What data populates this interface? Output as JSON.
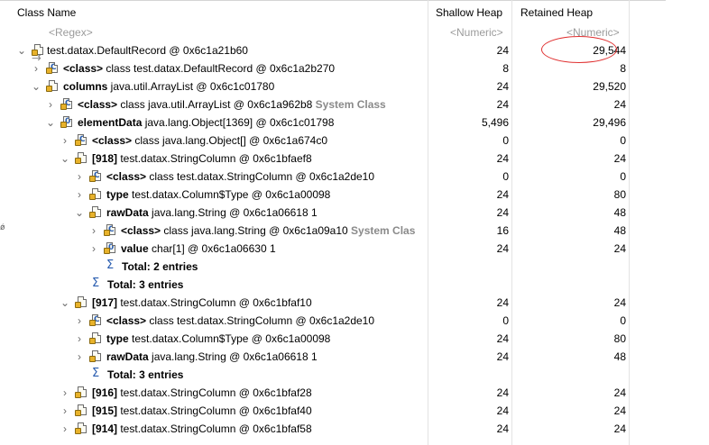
{
  "columns": {
    "class_name": "Class Name",
    "shallow": "Shallow Heap",
    "retained": "Retained Heap"
  },
  "filters": {
    "regex": "<Regex>",
    "numeric1": "<Numeric>",
    "numeric2": "<Numeric>"
  },
  "rows": [
    {
      "bold": "",
      "text": "test.datax.DefaultRecord @ 0x6c1a21b60",
      "extra": "",
      "shallow": "24",
      "retained": "29,544"
    },
    {
      "bold": "<class>",
      "text": " class test.datax.DefaultRecord @ 0x6c1a2b270",
      "extra": "",
      "shallow": "8",
      "retained": "8"
    },
    {
      "bold": "columns",
      "text": " java.util.ArrayList @ 0x6c1c01780",
      "extra": "",
      "shallow": "24",
      "retained": "29,520"
    },
    {
      "bold": "<class>",
      "text": " class java.util.ArrayList @ 0x6c1a962b8",
      "extra": " System Class",
      "shallow": "24",
      "retained": "24"
    },
    {
      "bold": "elementData",
      "text": " java.lang.Object[1369] @ 0x6c1c01798",
      "extra": "",
      "shallow": "5,496",
      "retained": "29,496"
    },
    {
      "bold": "<class>",
      "text": " class java.lang.Object[] @ 0x6c1a674c0",
      "extra": "",
      "shallow": "0",
      "retained": "0"
    },
    {
      "bold": "[918]",
      "text": " test.datax.StringColumn @ 0x6c1bfaef8",
      "extra": "",
      "shallow": "24",
      "retained": "24"
    },
    {
      "bold": "<class>",
      "text": " class test.datax.StringColumn @ 0x6c1a2de10",
      "extra": "",
      "shallow": "0",
      "retained": "0"
    },
    {
      "bold": "type",
      "text": " test.datax.Column$Type @ 0x6c1a00098",
      "extra": "",
      "shallow": "24",
      "retained": "80"
    },
    {
      "bold": "rawData",
      "text": " java.lang.String @ 0x6c1a06618  1",
      "extra": "",
      "shallow": "24",
      "retained": "48"
    },
    {
      "bold": "<class>",
      "text": " class java.lang.String @ 0x6c1a09a10",
      "extra": " System Clas",
      "shallow": "16",
      "retained": "48"
    },
    {
      "bold": "value",
      "text": " char[1] @ 0x6c1a06630  1",
      "extra": "",
      "shallow": "24",
      "retained": "24"
    },
    {
      "bold": "Total: 2 entries",
      "text": "",
      "extra": "",
      "shallow": "",
      "retained": ""
    },
    {
      "bold": "Total: 3 entries",
      "text": "",
      "extra": "",
      "shallow": "",
      "retained": ""
    },
    {
      "bold": "[917]",
      "text": " test.datax.StringColumn @ 0x6c1bfaf10",
      "extra": "",
      "shallow": "24",
      "retained": "24"
    },
    {
      "bold": "<class>",
      "text": " class test.datax.StringColumn @ 0x6c1a2de10",
      "extra": "",
      "shallow": "0",
      "retained": "0"
    },
    {
      "bold": "type",
      "text": " test.datax.Column$Type @ 0x6c1a00098",
      "extra": "",
      "shallow": "24",
      "retained": "80"
    },
    {
      "bold": "rawData",
      "text": " java.lang.String @ 0x6c1a06618  1",
      "extra": "",
      "shallow": "24",
      "retained": "48"
    },
    {
      "bold": "Total: 3 entries",
      "text": "",
      "extra": "",
      "shallow": "",
      "retained": ""
    },
    {
      "bold": "[916]",
      "text": " test.datax.StringColumn @ 0x6c1bfaf28",
      "extra": "",
      "shallow": "24",
      "retained": "24"
    },
    {
      "bold": "[915]",
      "text": " test.datax.StringColumn @ 0x6c1bfaf40",
      "extra": "",
      "shallow": "24",
      "retained": "24"
    },
    {
      "bold": "[914]",
      "text": " test.datax.StringColumn @ 0x6c1bfaf58",
      "extra": "",
      "shallow": "24",
      "retained": "24"
    }
  ]
}
